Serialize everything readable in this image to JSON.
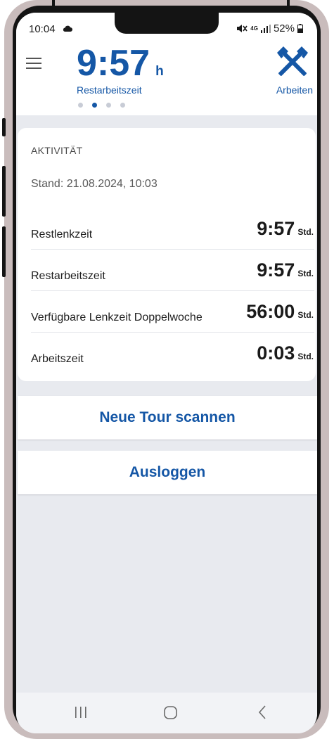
{
  "status_bar": {
    "time": "10:04",
    "network": "4G",
    "battery": "52%",
    "icons": [
      "cloud-icon",
      "mute-icon",
      "signal-icon",
      "battery-icon"
    ]
  },
  "header": {
    "remaining_time_value": "9:57",
    "remaining_time_unit": "h",
    "remaining_time_label": "Restarbeitszeit",
    "work_label": "Arbeiten",
    "page_count": 4,
    "active_page": 2,
    "accent_color": "#1557a6"
  },
  "activity": {
    "title": "AKTIVITÄT",
    "stand": "Stand: 21.08.2024, 10:03",
    "rows": [
      {
        "label": "Restlenkzeit",
        "value": "9:57",
        "unit": "Std."
      },
      {
        "label": "Restarbeitszeit",
        "value": "9:57",
        "unit": "Std."
      },
      {
        "label": "Verfügbare Lenkzeit Doppelwoche",
        "value": "56:00",
        "unit": "Std."
      },
      {
        "label": "Arbeitszeit",
        "value": "0:03",
        "unit": "Std."
      }
    ]
  },
  "actions": {
    "scan_label": "Neue Tour scannen",
    "logout_label": "Ausloggen"
  },
  "nav": {
    "icons": [
      "recent-apps-icon",
      "home-icon",
      "back-icon"
    ]
  }
}
